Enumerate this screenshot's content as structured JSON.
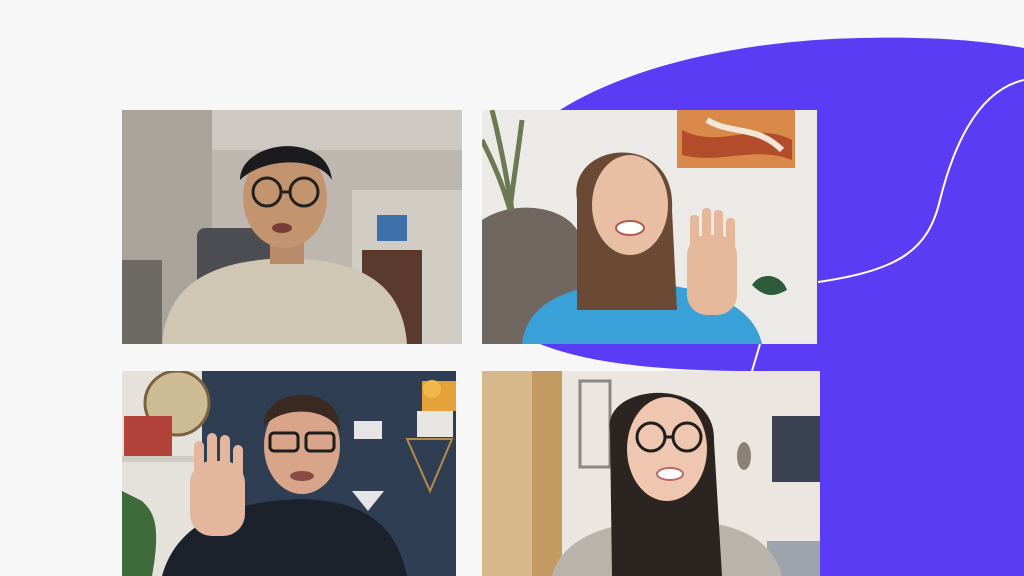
{
  "colors": {
    "page_background": "#f7f7f7",
    "accent_shape": "#5b3cf5",
    "accent_line": "#ffffff"
  },
  "participants": [
    {
      "id": "participant-1",
      "description_icon": "person-video-feed",
      "shirt_color": "#d9d2c3",
      "background_color": "#c8c2ba"
    },
    {
      "id": "participant-2",
      "description_icon": "person-video-feed",
      "shirt_color": "#3aa0d8",
      "background_color": "#efedea"
    },
    {
      "id": "participant-3",
      "description_icon": "person-video-feed",
      "shirt_color": "#1f2530",
      "background_color": "#2f3e52"
    },
    {
      "id": "participant-4",
      "description_icon": "person-video-feed",
      "shirt_color": "#b9b4ab",
      "background_color": "#ebe7e0"
    }
  ]
}
